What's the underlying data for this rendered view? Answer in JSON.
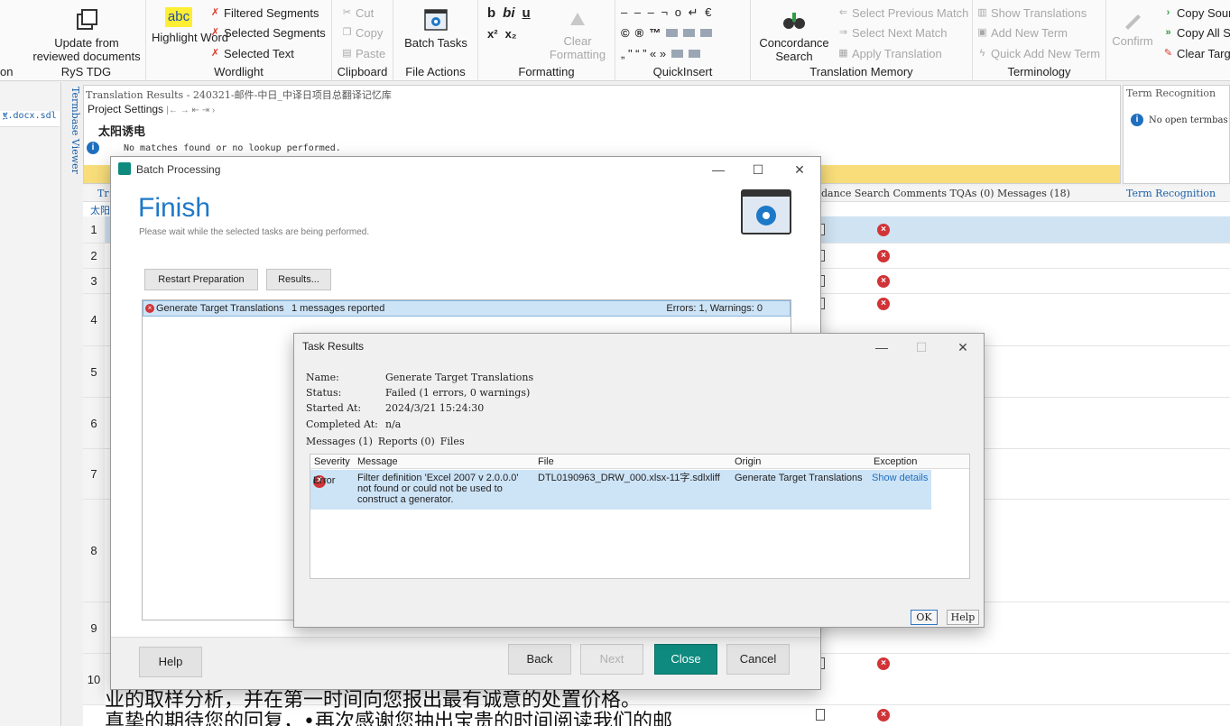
{
  "ribbon": {
    "partial_left": "on",
    "groups": {
      "rys": {
        "label": "RyS TDG",
        "update_btn": "Update from reviewed documents"
      },
      "wordlight": {
        "label": "Wordlight",
        "highlight_btn": "Highlight Word",
        "highlight_glyph": "abc",
        "items": [
          "Filtered Segments",
          "Selected Segments",
          "Selected Text"
        ]
      },
      "clipboard": {
        "label": "Clipboard",
        "items": [
          "Cut",
          "Copy",
          "Paste"
        ]
      },
      "file_actions": {
        "label": "File Actions",
        "batch_btn": "Batch Tasks"
      },
      "formatting": {
        "label": "Formatting",
        "clear_btn": "Clear Formatting"
      },
      "quickinsert": {
        "label": "QuickInsert",
        "glyph_row": "– – – ¬ o ↵ €"
      },
      "tm": {
        "label": "Translation Memory",
        "concordance_btn": "Concordance Search",
        "items": [
          "Select Previous Match",
          "Select Next Match",
          "Apply Translation",
          "Show Translations",
          "Add New Term",
          "Quick Add New Term"
        ]
      },
      "terminology": {
        "label": "Terminology",
        "confirm_btn": "Confirm"
      },
      "copy": {
        "items": [
          "Copy Sour",
          "Copy All S",
          "Clear Targ"
        ]
      }
    }
  },
  "left": {
    "file_tab": "፪.docx.sdl",
    "termbase_viewer": "Termbase Viewer"
  },
  "translation_results": {
    "title": "Translation Results - 240321-邮件-中日_中译日项目总翻译记忆库",
    "project_settings": "Project Settings",
    "source": "太阳诱电",
    "no_matches": "No matches found or no lookup performed."
  },
  "term_recognition": {
    "title": "Term Recognition",
    "text": "No open termbas",
    "tab": "Term Recognition"
  },
  "grid_tabs": {
    "left": "Tr",
    "right": "dance Search  Comments  TQAs (0)  Messages (18)"
  },
  "grid": {
    "row_header": "太阳",
    "rows": [
      {
        "num": "1"
      },
      {
        "num": "2"
      },
      {
        "num": "3"
      },
      {
        "num": "4"
      },
      {
        "num": "5"
      },
      {
        "num": "6"
      },
      {
        "num": "7"
      },
      {
        "num": "8"
      },
      {
        "num": "9"
      },
      {
        "num": "10"
      }
    ],
    "line_a": "业的取样分析，并在第一时间向您报出最有诚意的处置价格。",
    "line_b": "真挚的期待您的回复，•再次感谢您抽出宝贵的时间阅读我们的邮"
  },
  "batch": {
    "title": "Batch Processing",
    "finish": "Finish",
    "subtitle": "Please wait while the selected tasks are being performed.",
    "restart_btn": "Restart Preparation",
    "results_btn": "Results...",
    "task_name": "Generate Target Translations",
    "task_msgs": "1 messages reported",
    "task_summary": "Errors: 1, Warnings: 0",
    "help_btn": "Help",
    "back_btn": "Back",
    "next_btn": "Next",
    "close_btn": "Close",
    "cancel_btn": "Cancel"
  },
  "task_results": {
    "title": "Task Results",
    "name_k": "Name:",
    "name_v": "Generate Target Translations",
    "status_k": "Status:",
    "status_v": "Failed (1 errors, 0 warnings)",
    "started_k": "Started At:",
    "started_v": "2024/3/21 15:24:30",
    "completed_k": "Completed At:",
    "completed_v": "n/a",
    "tab_messages": "Messages (1)",
    "tab_reports": "Reports (0)",
    "tab_files": "Files",
    "col_severity": "Severity",
    "col_message": "Message",
    "col_file": "File",
    "col_origin": "Origin",
    "col_exception": "Exception",
    "row": {
      "severity": "Error",
      "message": "Filter definition 'Excel 2007 v 2.0.0.0' not found or could not be used to construct a generator.",
      "file": "DTL0190963_DRW_000.xlsx-11字.sdlxliff",
      "origin": "Generate Target Translations",
      "exception": "Show details"
    },
    "ok_btn": "OK",
    "help_btn": "Help"
  }
}
